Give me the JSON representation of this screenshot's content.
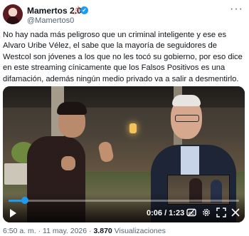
{
  "author": {
    "display_name": "Mamertos 2.0",
    "handle": "@Mamertos0",
    "emoji": "🌶",
    "verified_mark": "✓"
  },
  "more_menu": "···",
  "tweet": {
    "text": "No hay nada más peligroso que un criminal inteligente y ese es Alvaro Uribe Vélez, el sabe que la mayoría de seguidores de Westcol son jóvenes a los que no les tocó su gobierno, por eso dice en este streaming cínicamente que los Falsos Positivos es una difamación, además ningún medio privado va a salir a desmentirlo."
  },
  "video": {
    "elapsed": "0:06",
    "duration": "1:23",
    "time_label": "0:06 / 1:23",
    "progress_fraction": 0.072,
    "accent_color": "#1d9bf0",
    "controls": [
      "play-icon",
      "cc-icon",
      "gear-icon",
      "fullscreen-icon",
      "x-icon"
    ]
  },
  "meta": {
    "time": "6:50 a. m.",
    "date": "11 may. 2026",
    "views_count": "3.870",
    "views_label": "Visualizaciones",
    "separator": "·"
  }
}
